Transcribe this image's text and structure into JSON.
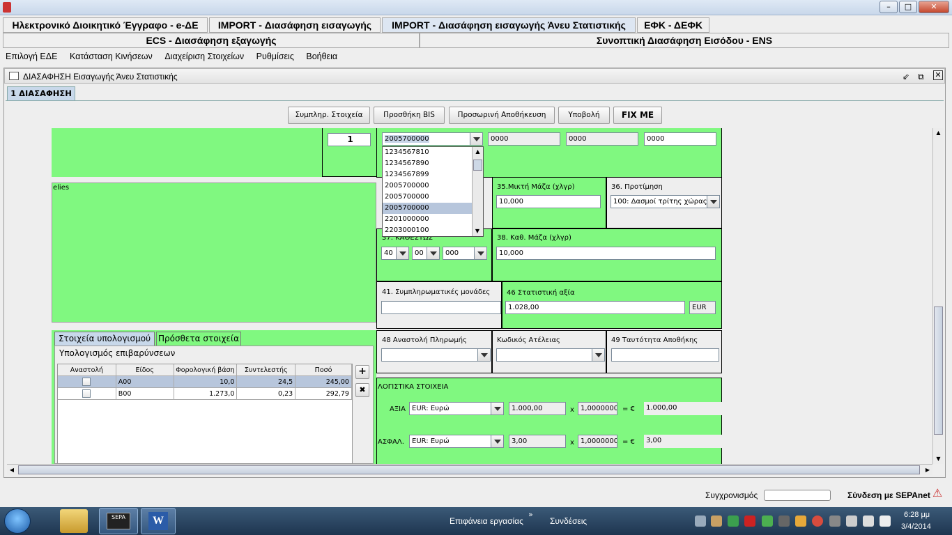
{
  "window": {
    "min_icon": "minimize-icon",
    "max_icon": "maximize-icon",
    "close_icon": "close-icon"
  },
  "top_tabs_row1": [
    "Ηλεκτρονικό Διοικητικό Έγγραφο - e-ΔΕ",
    "IMPORT - Διασάφηση εισαγωγής",
    "IMPORT - Διασάφηση εισαγωγής Άνευ Στατιστικής",
    "ΕΦΚ - ΔΕΦΚ"
  ],
  "top_tabs_row2": [
    "ECS - Διασάφηση εξαγωγής",
    "Συνοπτική Διασάφηση Εισόδου - ENS"
  ],
  "menu": [
    "Επιλογή ΕΔΕ",
    "Κατάσταση Κινήσεων",
    "Διαχείριση Στοιχείων",
    "Ρυθμίσεις",
    "Βοήθεια"
  ],
  "inner_window": {
    "title": "ΔΙΑΣΑΦΗΣΗ Εισαγωγής Άνευ Στατιστικής",
    "tab": "1 ΔΙΑΣΑΦΗΣΗ"
  },
  "actions": {
    "complete": "Συμπληρ. Στοιχεία",
    "add_bis": "Προσθήκη BIS",
    "save": "Προσωρινή Αποθήκευση",
    "submit": "Υποβολή",
    "fixme": "FIX ME"
  },
  "form": {
    "item_no": "1",
    "commodity_code": "2005700000",
    "code_fields": [
      "0000",
      "0000",
      "0000"
    ],
    "dropdown_options": [
      "1234567810",
      "1234567890",
      "1234567899",
      "2005700000",
      "2005700000",
      "2005700000",
      "2201000000",
      "2203000100"
    ],
    "dropdown_selected_index": 5,
    "description": "elies",
    "gross_mass_label": "35.Μικτή Μάζα (χλγρ)",
    "gross_mass": "10,000",
    "preference_label": "36. Προτίμηση",
    "preference": "100: Δασμοί τρίτης χώρας,...",
    "procedure_label": "37. ΚΑΘΕΣΤΩΣ",
    "procedure": [
      "40",
      "00",
      "000"
    ],
    "net_mass_label": "38. Καθ. Μάζα (χλγρ)",
    "net_mass": "10,000",
    "supp_units_label": "41. Συμπληρωματικές μονάδες",
    "supp_units": "",
    "stat_value_label": "46 Στατιστική αξία",
    "stat_value": "1.028,00",
    "stat_currency": "EUR",
    "payment_suspension_label": "48 Αναστολή Πληρωμής",
    "exemption_code_label": "Κωδικός Ατέλειας",
    "warehouse_label": "49 Ταυτότητα Αποθήκης",
    "accounting_label": "ΛΟΓΙΣΤΙΚΑ ΣΤΟΙΧΕΙΑ",
    "value_label": "ΑΞΙΑ",
    "value_currency": "EUR: Ευρώ",
    "value_amount": "1.000,00",
    "value_x": "x",
    "value_rate": "1,00000000",
    "value_eq": "= €",
    "value_result": "1.000,00",
    "insurance_label": "ΑΣΦΑΛ.",
    "ins_currency": "EUR: Ευρώ",
    "ins_amount": "3,00",
    "ins_x": "x",
    "ins_rate": "1,00000000",
    "ins_eq": "= €",
    "ins_result": "3,00"
  },
  "calc": {
    "tabs": [
      "Στοιχεία υπολογισμού",
      "Πρόσθετα στοιχεία"
    ],
    "group_title": "Υπολογισμός επιβαρύνσεων",
    "headers": [
      "Αναστολή",
      "Είδος",
      "Φορολογική βάση",
      "Συντελεστής",
      "Ποσό"
    ],
    "rows": [
      {
        "type": "A00",
        "base": "10,0",
        "rate": "24,5",
        "amount": "245,00"
      },
      {
        "type": "B00",
        "base": "1.273,0",
        "rate": "0,23",
        "amount": "292,79"
      }
    ]
  },
  "status": {
    "sync_label": "Συγχρονισμός",
    "sepa_label": "Σύνδεση με SEPAnet"
  },
  "taskbar": {
    "desktop": "Επιφάνεια εργασίας",
    "connections": "Συνδέσεις",
    "time": "6:28 μμ",
    "date": "3/4/2014",
    "sepa_app": "SEPA"
  },
  "colors": {
    "form_green": "#80f880",
    "taskbar": "#2a4663"
  }
}
